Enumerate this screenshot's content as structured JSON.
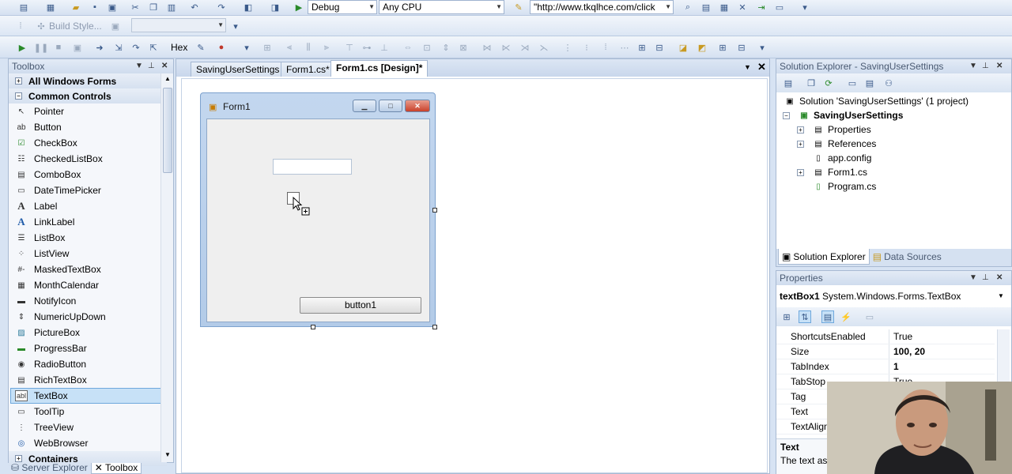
{
  "toolbar1": {
    "config_combo": "Debug",
    "platform_combo": "Any CPU",
    "url_combo": "\"http://www.tkqlhce.com/click"
  },
  "toolbar2": {
    "build_style_label": "Build Style..."
  },
  "toolbar3": {
    "hex_label": "Hex"
  },
  "toolbox": {
    "title": "Toolbox",
    "category_all": "All Windows Forms",
    "category_common": "Common Controls",
    "items": [
      "Pointer",
      "Button",
      "CheckBox",
      "CheckedListBox",
      "ComboBox",
      "DateTimePicker",
      "Label",
      "LinkLabel",
      "ListBox",
      "ListView",
      "MaskedTextBox",
      "MonthCalendar",
      "NotifyIcon",
      "NumericUpDown",
      "PictureBox",
      "ProgressBar",
      "RadioButton",
      "RichTextBox",
      "TextBox",
      "ToolTip",
      "TreeView",
      "WebBrowser"
    ],
    "selected_item": "TextBox",
    "category_containers": "Containers",
    "bottom_tabs": [
      "Server Explorer",
      "Toolbox"
    ]
  },
  "document": {
    "tabs": [
      "SavingUserSettings",
      "Form1.cs*",
      "Form1.cs [Design]*"
    ],
    "active_tab": "Form1.cs [Design]*"
  },
  "form1": {
    "title": "Form1",
    "button_text": "button1"
  },
  "solution_explorer": {
    "title": "Solution Explorer - SavingUserSettings",
    "solution_label": "Solution 'SavingUserSettings' (1 project)",
    "project_label": "SavingUserSettings",
    "items": [
      "Properties",
      "References",
      "app.config",
      "Form1.cs",
      "Program.cs"
    ],
    "tabs": [
      "Solution Explorer",
      "Data Sources"
    ]
  },
  "properties": {
    "title": "Properties",
    "object_name": "textBox1",
    "object_type": "System.Windows.Forms.TextBox",
    "rows": [
      {
        "name": "ShortcutsEnabled",
        "value": "True"
      },
      {
        "name": "Size",
        "value": "100, 20"
      },
      {
        "name": "TabIndex",
        "value": "1"
      },
      {
        "name": "TabStop",
        "value": "True"
      },
      {
        "name": "Tag",
        "value": ""
      },
      {
        "name": "Text",
        "value": ""
      },
      {
        "name": "TextAlign",
        "value": ""
      }
    ],
    "desc_title": "Text",
    "desc_text": "The text associated with the control."
  }
}
